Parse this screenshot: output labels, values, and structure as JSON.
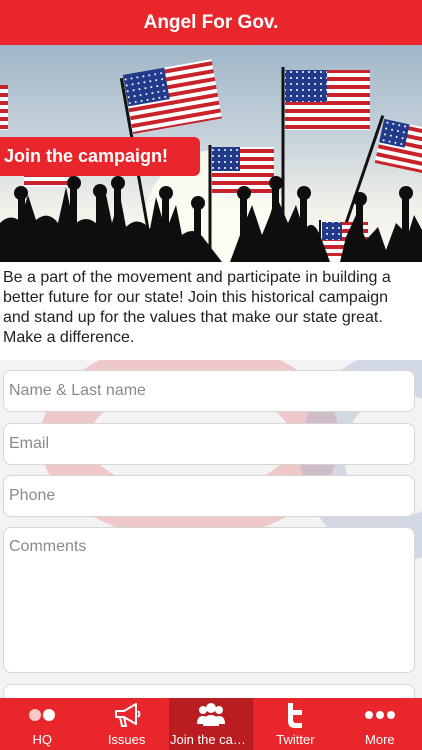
{
  "header": {
    "title": "Angel For Gov."
  },
  "hero": {
    "banner": "Join the campaign!"
  },
  "intro": {
    "text": "Be a part of the movement and participate in building a better future for our state! Join this historical campaign and stand up for the values that make our state great. Make a difference."
  },
  "form": {
    "name_placeholder": "Name & Last name",
    "email_placeholder": "Email",
    "phone_placeholder": "Phone",
    "comments_placeholder": "Comments"
  },
  "tabs": [
    {
      "label": "HQ",
      "icon": "dots-icon"
    },
    {
      "label": "Issues",
      "icon": "megaphone-icon"
    },
    {
      "label": "Join the campaign",
      "icon": "group-icon",
      "active": true
    },
    {
      "label": "Twitter",
      "icon": "twitter-icon"
    },
    {
      "label": "More",
      "icon": "more-icon"
    }
  ],
  "colors": {
    "accent": "#e8262b",
    "accent_dark": "#b91d22"
  }
}
